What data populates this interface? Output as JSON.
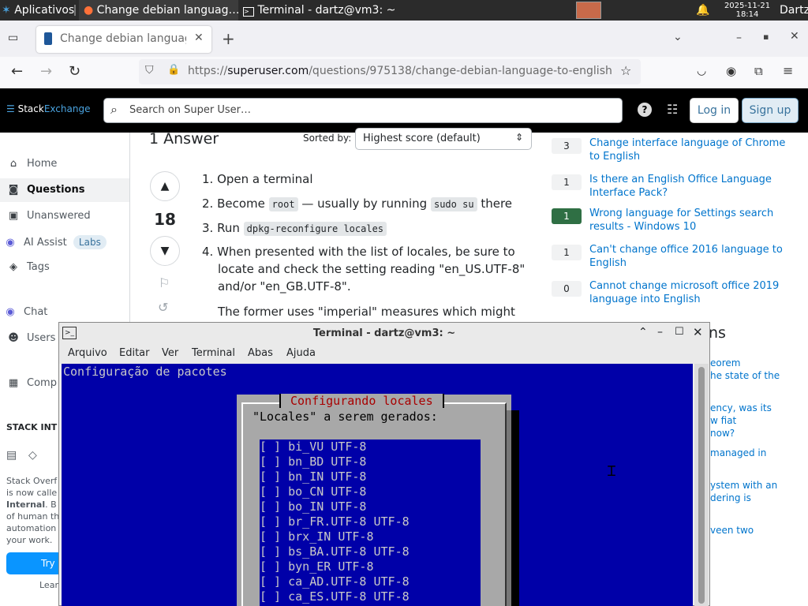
{
  "taskbar": {
    "apps_label": "Aplicativos",
    "task1": "Change debian languag…",
    "task2": "Terminal - dartz@vm3: ~",
    "date": "2025-11-21",
    "time": "18:14",
    "user": "Dartz"
  },
  "browser": {
    "tab_title": "Change debian language",
    "url_prefix": "https://",
    "url_domain": "superuser.com",
    "url_path": "/questions/975138/change-debian-language-to-english"
  },
  "se": {
    "logo_a": "Stack",
    "logo_b": "Exchange",
    "search_placeholder": "Search on Super User…",
    "login": "Log in",
    "signup": "Sign up"
  },
  "sidebar": {
    "home": "Home",
    "questions": "Questions",
    "unanswered": "Unanswered",
    "ai_assist": "AI Assist",
    "labs": "Labs",
    "tags": "Tags",
    "chat": "Chat",
    "users": "Users",
    "companies": "Comp",
    "stack_internal": "STACK INT",
    "promo_line1": "Stack Overf",
    "promo_line2": "is now calle",
    "promo_line3_bold": "Internal",
    "promo_line3_rest": ". B",
    "promo_line4": "of human th",
    "promo_line5": "automation",
    "promo_line6": "your work.",
    "try_btn": "Try",
    "learn": "Lear"
  },
  "answer": {
    "count_label": "1 Answer",
    "sorted_by": "Sorted by:",
    "sort_value": "Highest score (default)",
    "score": "18",
    "step1": "Open a terminal",
    "step2_a": "Become",
    "step2_code1": "root",
    "step2_b": "— usually by running",
    "step2_code2": "sudo su",
    "step2_c": "there",
    "step3_a": "Run",
    "step3_code": "dpkg-reconfigure locales",
    "step4": "When presented with the list of locales, be sure to locate and check the setting reading \"en_US.UTF-8\" and/or \"en_GB.UTF-8\".",
    "para": "The former uses \"imperial\" measures which might"
  },
  "related": [
    {
      "count": "3",
      "title": "Change interface language of Chrome to English",
      "accepted": false
    },
    {
      "count": "1",
      "title": "Is there an English Office Language Interface Pack?",
      "accepted": false
    },
    {
      "count": "1",
      "title": "Wrong language for Settings search results - Windows 10",
      "accepted": true
    },
    {
      "count": "1",
      "title": "Can't change office 2016 language to English",
      "accepted": false
    },
    {
      "count": "0",
      "title": "Cannot change microsoft office 2019 language into English",
      "accepted": false
    }
  ],
  "hot": {
    "heading_frag": "ns",
    "f1a": "eorem",
    "f1b": "he state of the",
    "f2a": "ency, was its",
    "f2b": "w fiat",
    "f2c": "now?",
    "f3a": "managed in",
    "f4a": "ystem with an",
    "f4b": "dering is",
    "f5a": "veen two"
  },
  "terminal": {
    "title": "Terminal - dartz@vm3: ~",
    "menu": [
      "Arquivo",
      "Editar",
      "Ver",
      "Terminal",
      "Abas",
      "Ajuda"
    ],
    "header": "Configuração de pacotes",
    "dialog_title": "Configurando locales",
    "dialog_prompt": "\"Locales\" a serem gerados:",
    "locales": [
      "[ ] bi_VU UTF-8",
      "[ ] bn_BD UTF-8",
      "[ ] bn_IN UTF-8",
      "[ ] bo_CN UTF-8",
      "[ ] bo_IN UTF-8",
      "[ ] br_FR.UTF-8 UTF-8",
      "[ ] brx_IN UTF-8",
      "[ ] bs_BA.UTF-8 UTF-8",
      "[ ] byn_ER UTF-8",
      "[ ] ca_AD.UTF-8 UTF-8",
      "[ ] ca_ES.UTF-8 UTF-8"
    ]
  },
  "colors": {
    "terminal_bg": "#0000a8",
    "dialog_bg": "#a8a8a8",
    "dialog_title": "#a80000",
    "accepted_green": "#2f6f44",
    "link_blue": "#0074cc"
  }
}
